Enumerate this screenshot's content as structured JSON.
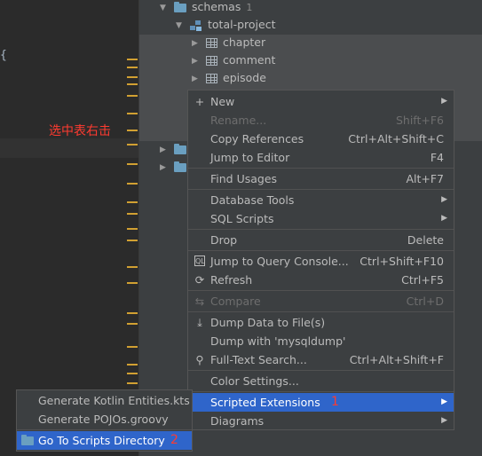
{
  "editor": {
    "brace": "{",
    "annotation": "选中表右击"
  },
  "tree": {
    "schemas": {
      "label": "schemas",
      "count": "1"
    },
    "project": {
      "label": "total-project"
    },
    "tables": [
      {
        "label": "chapter"
      },
      {
        "label": "comment"
      },
      {
        "label": "episode"
      }
    ]
  },
  "menu": {
    "items": [
      {
        "label": "New",
        "shortcut": "",
        "submenu": true,
        "icon": "plus-icon"
      },
      {
        "label": "Rename...",
        "shortcut": "Shift+F6",
        "disabled": true
      },
      {
        "label": "Copy References",
        "shortcut": "Ctrl+Alt+Shift+C"
      },
      {
        "label": "Jump to Editor",
        "shortcut": "F4"
      },
      {
        "label": "Find Usages",
        "shortcut": "Alt+F7"
      },
      {
        "label": "Database Tools",
        "shortcut": "",
        "submenu": true
      },
      {
        "label": "SQL Scripts",
        "shortcut": "",
        "submenu": true
      },
      {
        "label": "Drop",
        "shortcut": "Delete"
      },
      {
        "label": "Jump to Query Console...",
        "shortcut": "Ctrl+Shift+F10",
        "icon": "query-console-icon"
      },
      {
        "label": "Refresh",
        "shortcut": "Ctrl+F5",
        "icon": "refresh-icon"
      },
      {
        "label": "Compare",
        "shortcut": "Ctrl+D",
        "disabled": true,
        "icon": "compare-icon"
      },
      {
        "label": "Dump Data to File(s)",
        "shortcut": "",
        "icon": "download-icon"
      },
      {
        "label": "Dump with 'mysqldump'",
        "shortcut": ""
      },
      {
        "label": "Full-Text Search...",
        "shortcut": "Ctrl+Alt+Shift+F",
        "icon": "search-icon"
      },
      {
        "label": "Color Settings...",
        "shortcut": ""
      },
      {
        "label": "Scripted Extensions",
        "shortcut": "",
        "submenu": true,
        "active": true
      },
      {
        "label": "Diagrams",
        "shortcut": "",
        "submenu": true
      }
    ],
    "annotation_number": "1"
  },
  "submenu": {
    "items": [
      {
        "label": "Generate Kotlin Entities.kts"
      },
      {
        "label": "Generate POJOs.groovy"
      },
      {
        "label": "Go To Scripts Directory",
        "active": true
      }
    ],
    "annotation_number": "2"
  },
  "colors": {
    "accent": "#2f65ca",
    "annotation": "#ff3b30",
    "background": "#3c3f41",
    "editor_bg": "#2b2b2b"
  }
}
